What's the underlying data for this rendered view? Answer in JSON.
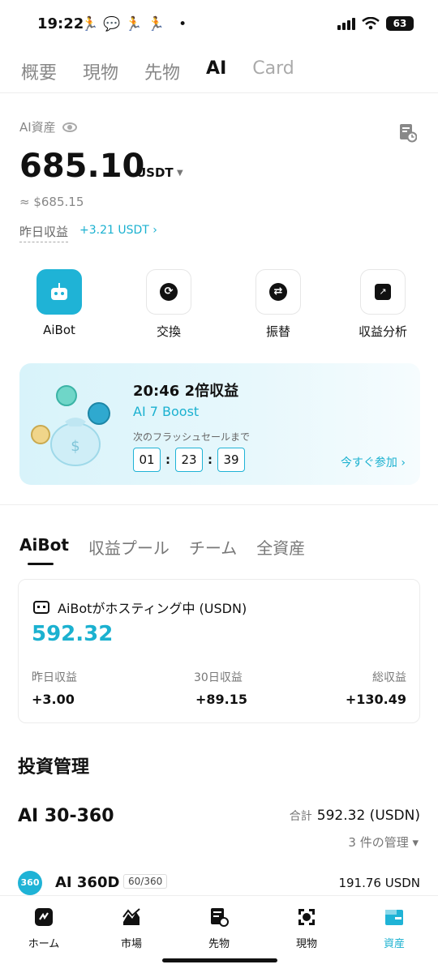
{
  "status_bar": {
    "time": "19:22",
    "battery": "63"
  },
  "top_tabs": [
    {
      "label": "概要"
    },
    {
      "label": "現物"
    },
    {
      "label": "先物"
    },
    {
      "label": "AI"
    },
    {
      "label": "Card"
    }
  ],
  "asset": {
    "label": "AI資産",
    "balance": "685.10",
    "unit": "USDT",
    "approx": "≈ $685.15",
    "yesterday_label": "昨日収益",
    "yesterday_value": "+3.21 USDT ›"
  },
  "shortcuts": [
    {
      "label": "AiBot",
      "icon": "robot-icon"
    },
    {
      "label": "交換",
      "icon": "exchange-icon"
    },
    {
      "label": "振替",
      "icon": "transfer-icon"
    },
    {
      "label": "収益分析",
      "icon": "chart-icon"
    }
  ],
  "promo": {
    "title": "20:46  2倍収益",
    "subtitle": "AI 7 Boost",
    "note": "次のフラッシュセールまで",
    "timer": [
      "01",
      "23",
      "39"
    ],
    "cta": "今すぐ参加 ›"
  },
  "sub_tabs": [
    {
      "label": "AiBot"
    },
    {
      "label": "収益プール"
    },
    {
      "label": "チーム"
    },
    {
      "label": "全資産"
    }
  ],
  "bot_card": {
    "title": "AiBotがホスティング中 (USDN)",
    "amount": "592.32",
    "stats": [
      {
        "label": "昨日収益",
        "value": "+3.00"
      },
      {
        "label": "30日収益",
        "value": "+89.15"
      },
      {
        "label": "総収益",
        "value": "+130.49"
      }
    ]
  },
  "investment": {
    "heading": "投資管理",
    "name": "AI 30-360",
    "total_label": "合計",
    "total_value": "592.32 (USDN)",
    "manage": "3 件の管理 ▾",
    "row": {
      "badge": "360",
      "name": "AI 360D",
      "progress": "60/360",
      "amount": "191.76 USDN"
    }
  },
  "bottom_nav": [
    {
      "label": "ホーム",
      "icon": "home-icon"
    },
    {
      "label": "市場",
      "icon": "market-icon"
    },
    {
      "label": "先物",
      "icon": "futures-icon"
    },
    {
      "label": "現物",
      "icon": "spot-icon"
    },
    {
      "label": "資産",
      "icon": "assets-icon"
    }
  ],
  "colors": {
    "accent": "#1bb1d0",
    "text": "#111111"
  }
}
